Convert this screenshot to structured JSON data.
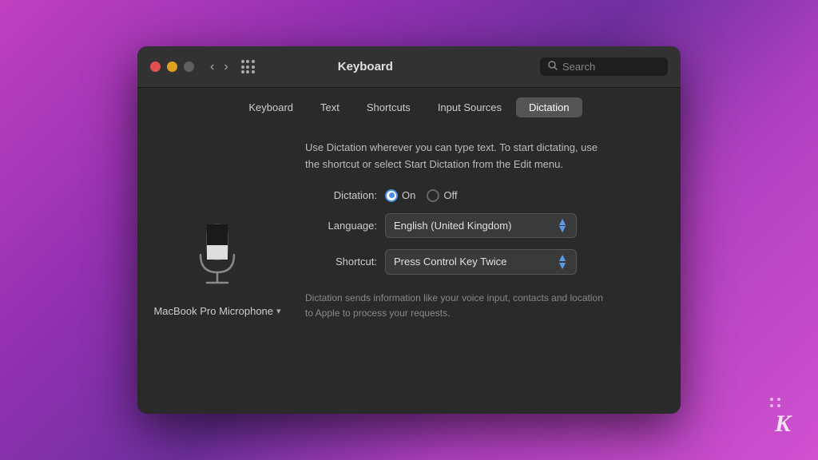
{
  "background": {
    "gradient_start": "#c040c0",
    "gradient_end": "#7030a0"
  },
  "window": {
    "title": "Keyboard"
  },
  "titlebar": {
    "search_placeholder": "Search",
    "nav_back": "‹",
    "nav_forward": "›"
  },
  "tabs": [
    {
      "id": "keyboard",
      "label": "Keyboard",
      "active": false
    },
    {
      "id": "text",
      "label": "Text",
      "active": false
    },
    {
      "id": "shortcuts",
      "label": "Shortcuts",
      "active": false
    },
    {
      "id": "input-sources",
      "label": "Input Sources",
      "active": false
    },
    {
      "id": "dictation",
      "label": "Dictation",
      "active": true
    }
  ],
  "dictation": {
    "description": "Use Dictation wherever you can type text. To start dictating,\nuse the shortcut or select Start Dictation from the Edit menu.",
    "microphone_label": "MacBook Pro Microphone",
    "dictation_label": "Dictation:",
    "on_label": "On",
    "off_label": "Off",
    "language_label": "Language:",
    "language_value": "English (United Kingdom)",
    "shortcut_label": "Shortcut:",
    "shortcut_value": "Press Control Key Twice",
    "footnote": "Dictation sends information like your voice input, contacts and\nlocation to Apple to process your requests."
  },
  "logo": {
    "letter": "K"
  }
}
